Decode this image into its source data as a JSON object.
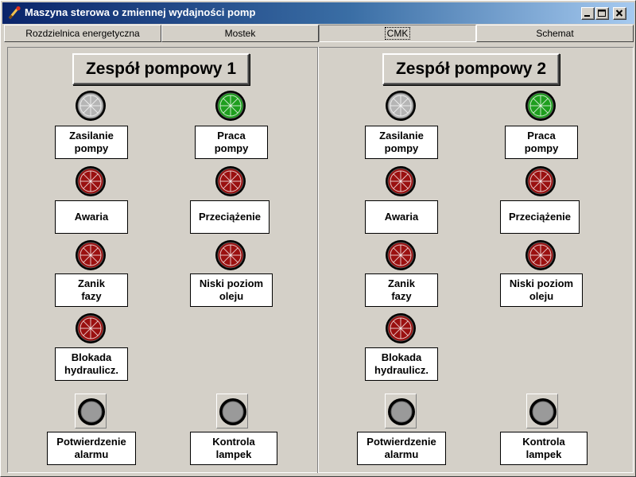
{
  "window": {
    "title": "Maszyna sterowa o zmiennej wydajności pomp"
  },
  "tabs": [
    {
      "label": "Rozdzielnica energetyczna"
    },
    {
      "label": "Mostek"
    },
    {
      "label": "CMK"
    },
    {
      "label": "Schemat"
    }
  ],
  "colors": {
    "lamp_gray": "#b5b5b5",
    "lamp_green": "#1e9e1e",
    "lamp_red": "#9a1010"
  },
  "groups": [
    {
      "title": "Zespół pompowy 1",
      "indicators": [
        {
          "label": "Zasilanie\npompy",
          "state": "gray"
        },
        {
          "label": "Praca\npompy",
          "state": "green"
        },
        {
          "label": "Awaria",
          "state": "red"
        },
        {
          "label": "Przeciążenie",
          "state": "red"
        },
        {
          "label": "Zanik\nfazy",
          "state": "red"
        },
        {
          "label": "Niski poziom\noleju",
          "state": "red"
        },
        {
          "label": "Blokada\nhydraulicz.",
          "state": "red"
        }
      ],
      "buttons": [
        {
          "label": "Potwierdzenie\nalarmu"
        },
        {
          "label": "Kontrola\nlampek"
        }
      ]
    },
    {
      "title": "Zespół pompowy 2",
      "indicators": [
        {
          "label": "Zasilanie\npompy",
          "state": "gray"
        },
        {
          "label": "Praca\npompy",
          "state": "green"
        },
        {
          "label": "Awaria",
          "state": "red"
        },
        {
          "label": "Przeciążenie",
          "state": "red"
        },
        {
          "label": "Zanik\nfazy",
          "state": "red"
        },
        {
          "label": "Niski poziom\noleju",
          "state": "red"
        },
        {
          "label": "Blokada\nhydraulicz.",
          "state": "red"
        }
      ],
      "buttons": [
        {
          "label": "Potwierdzenie\nalarmu"
        },
        {
          "label": "Kontrola\nlampek"
        }
      ]
    }
  ]
}
